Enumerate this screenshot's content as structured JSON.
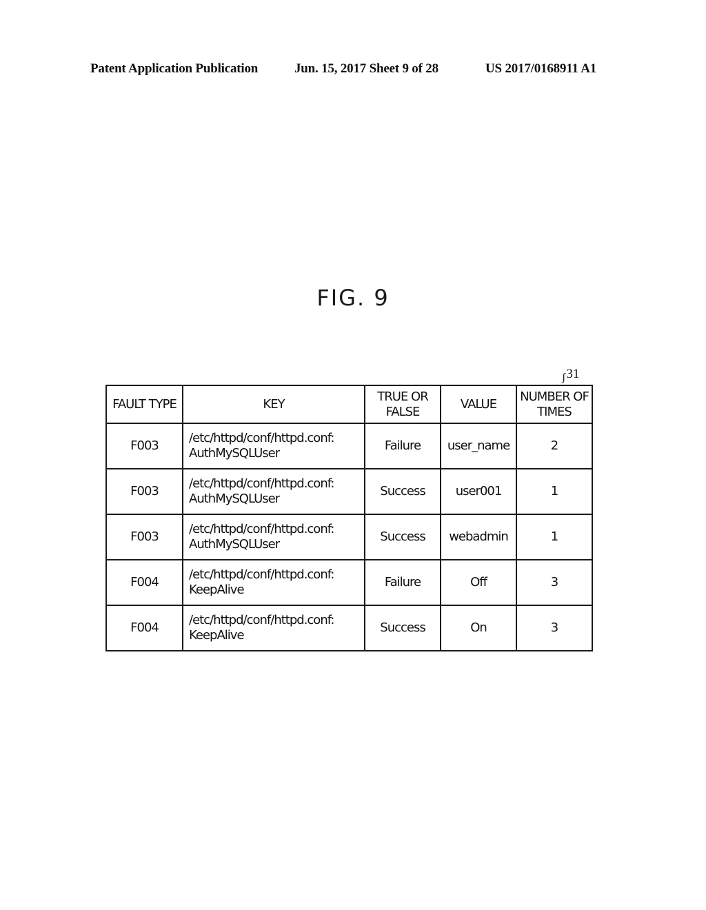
{
  "header": {
    "publication": "Patent Application Publication",
    "date_sheet": "Jun. 15, 2017  Sheet 9 of 28",
    "number": "US 2017/0168911 A1"
  },
  "figure": {
    "title": "FIG. 9",
    "reference_numeral": "31"
  },
  "table": {
    "columns": [
      "FAULT TYPE",
      "KEY",
      "TRUE OR FALSE",
      "VALUE",
      "NUMBER OF TIMES"
    ],
    "rows": [
      {
        "fault_type": "F003",
        "key_line1": "/etc/httpd/conf/httpd.conf:",
        "key_line2": "AuthMySQLUser",
        "true_or_false": "Failure",
        "value": "user_name",
        "times": "2"
      },
      {
        "fault_type": "F003",
        "key_line1": "/etc/httpd/conf/httpd.conf:",
        "key_line2": "AuthMySQLUser",
        "true_or_false": "Success",
        "value": "user001",
        "times": "1"
      },
      {
        "fault_type": "F003",
        "key_line1": "/etc/httpd/conf/httpd.conf:",
        "key_line2": "AuthMySQLUser",
        "true_or_false": "Success",
        "value": "webadmin",
        "times": "1"
      },
      {
        "fault_type": "F004",
        "key_line1": "/etc/httpd/conf/httpd.conf:",
        "key_line2": "KeepAlive",
        "true_or_false": "Failure",
        "value": "Off",
        "times": "3"
      },
      {
        "fault_type": "F004",
        "key_line1": "/etc/httpd/conf/httpd.conf:",
        "key_line2": "KeepAlive",
        "true_or_false": "Success",
        "value": "On",
        "times": "3"
      }
    ]
  }
}
